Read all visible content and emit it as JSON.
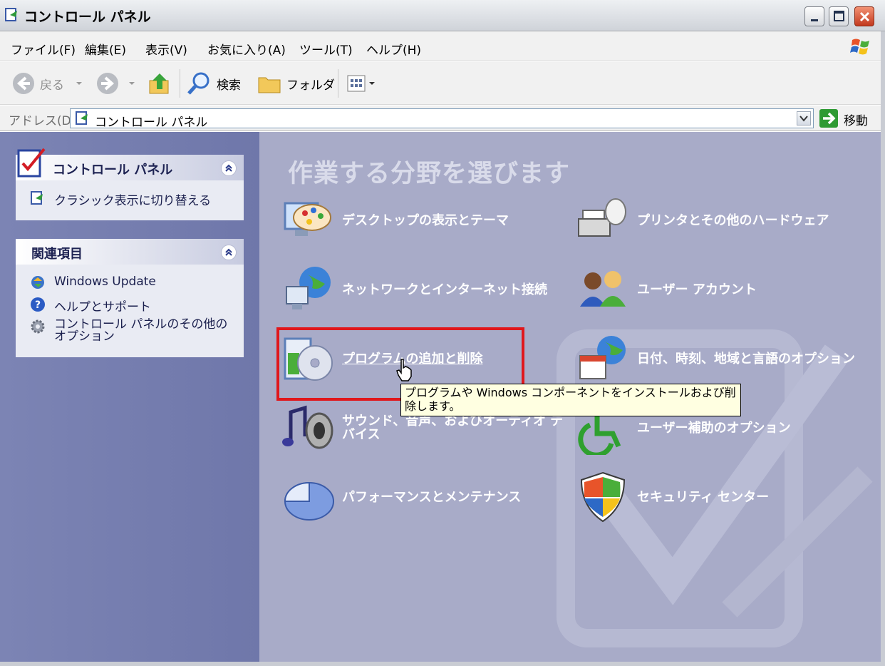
{
  "window": {
    "title": "コントロール パネル"
  },
  "menu": {
    "items": [
      "ファイル(F)",
      "編集(E)",
      "表示(V)",
      "お気に入り(A)",
      "ツール(T)",
      "ヘルプ(H)"
    ]
  },
  "toolbar": {
    "back_label": "戻る",
    "search_label": "検索",
    "folders_label": "フォルダ"
  },
  "address": {
    "label": "アドレス(D)",
    "value": "コントロール パネル",
    "go_label": "移動"
  },
  "sidebar": {
    "panel1": {
      "title": "コントロール パネル",
      "link": "クラシック表示に切り替える"
    },
    "panel2": {
      "title": "関連項目",
      "links": [
        "Windows Update",
        "ヘルプとサポート",
        "コントロール パネルのその他のオプション"
      ]
    }
  },
  "main": {
    "heading": "作業する分野を選びます",
    "categories": [
      {
        "label": "デスクトップの表示とテーマ",
        "icon": "desktop-theme-icon"
      },
      {
        "label": "プリンタとその他のハードウェア",
        "icon": "printer-icon"
      },
      {
        "label": "ネットワークとインターネット接続",
        "icon": "network-icon"
      },
      {
        "label": "ユーザー アカウント",
        "icon": "user-accounts-icon"
      },
      {
        "label": "プログラムの追加と削除",
        "icon": "add-remove-programs-icon"
      },
      {
        "label": "日付、時刻、地域と言語のオプション",
        "icon": "date-time-region-icon"
      },
      {
        "label": "サウンド、音声、およびオーディオ デバイス",
        "icon": "sound-icon"
      },
      {
        "label": "ユーザー補助のオプション",
        "icon": "accessibility-icon"
      },
      {
        "label": "パフォーマンスとメンテナンス",
        "icon": "performance-icon"
      },
      {
        "label": "セキュリティ センター",
        "icon": "security-center-icon"
      }
    ]
  },
  "tooltip": {
    "text": "プログラムや Windows コンポーネントをインストールおよび削除します。"
  },
  "colors": {
    "left_pane": "#7c84b4",
    "main_pane": "#a8abc8",
    "highlight": "#e0171c",
    "tooltip_bg": "#ffffe1"
  }
}
